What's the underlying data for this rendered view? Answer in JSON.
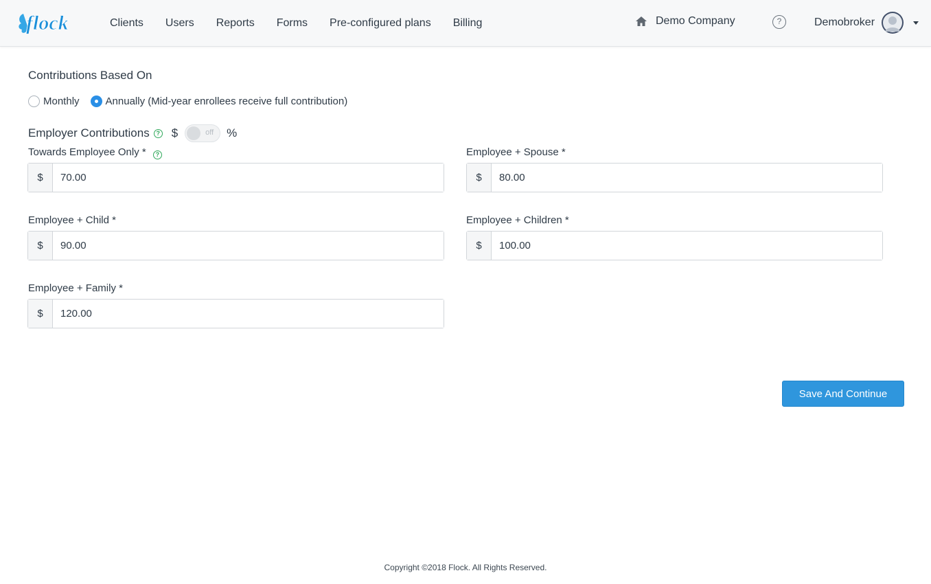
{
  "header": {
    "logo_text": "flock",
    "nav": [
      "Clients",
      "Users",
      "Reports",
      "Forms",
      "Pre-configured plans",
      "Billing"
    ],
    "company": "Demo Company",
    "help_symbol": "?",
    "user": "Demobroker"
  },
  "contributions": {
    "title": "Contributions Based On",
    "options": [
      "Monthly",
      "Annually (Mid-year enrollees receive full contribution)"
    ],
    "selected_index": 1
  },
  "employer": {
    "title": "Employer Contributions",
    "dollar_symbol": "$",
    "toggle_text": "off",
    "percent_symbol": "%"
  },
  "fields": {
    "employee_only": {
      "label": "Towards Employee Only *",
      "prefix": "$",
      "value": "70.00"
    },
    "employee_spouse": {
      "label": "Employee + Spouse *",
      "prefix": "$",
      "value": "80.00"
    },
    "employee_child": {
      "label": "Employee + Child *",
      "prefix": "$",
      "value": "90.00"
    },
    "employee_children": {
      "label": "Employee + Children *",
      "prefix": "$",
      "value": "100.00"
    },
    "employee_family": {
      "label": "Employee + Family *",
      "prefix": "$",
      "value": "120.00"
    }
  },
  "actions": {
    "save_label": "Save And Continue"
  },
  "footer": {
    "copyright": "Copyright ©2018 Flock. All Rights Reserved."
  },
  "colors": {
    "accent": "#2f96dd",
    "radio_checked": "#2a8fe6",
    "help_green": "#2fa85a"
  }
}
